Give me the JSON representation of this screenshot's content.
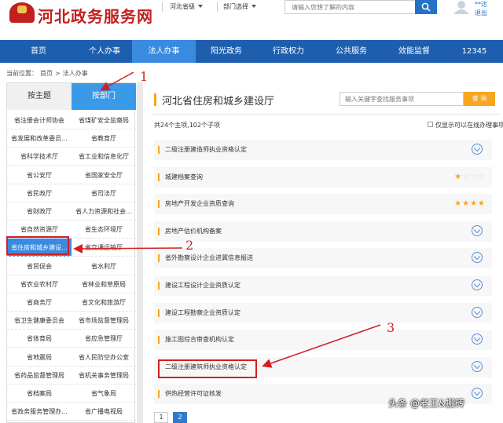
{
  "header": {
    "logo_text": "河北政务服务网",
    "province_select": "河北省级",
    "dept_select": "部门选择",
    "search_placeholder": "请输入您想了解的内容",
    "user_name": "**达",
    "logout": "退出"
  },
  "nav": {
    "items": [
      "首页",
      "个人办事",
      "法人办事",
      "阳光政务",
      "行政权力",
      "公共服务",
      "效能监督",
      "12345"
    ],
    "active_index": 2
  },
  "breadcrumb": {
    "prefix": "当前位置：",
    "home": "首页",
    "sep": ">",
    "current": "法人办事"
  },
  "left_tabs": {
    "by_subject": "按主题",
    "by_dept": "按部门"
  },
  "departments": [
    "省注册会计师协会",
    "省煤矿安全监察局",
    "省发展和改革委员...",
    "省教育厅",
    "省科学技术厅",
    "省工业和信息化厅",
    "省公安厅",
    "省国家安全厅",
    "省民政厅",
    "省司法厅",
    "省财政厅",
    "省人力资源和社会...",
    "省自然资源厅",
    "省生态环境厅",
    "省住房和城乡建设...",
    "省交通运输厅",
    "省贸促会",
    "省水利厅",
    "省农业农村厅",
    "省林业和草原局",
    "省商务厅",
    "省文化和旅游厅",
    "省卫生健康委员会",
    "省市场监督管理局",
    "省体育局",
    "省应急管理厅",
    "省地震局",
    "省人民防空办公室",
    "省药品监督管理局",
    "省机关事务管理局",
    "省档案局",
    "省气象局",
    "省政务服务管理办...",
    "省广播电视局"
  ],
  "active_department": "省住房和城乡建设...",
  "main": {
    "title": "河北省住房和城乡建设厅",
    "search_placeholder": "输入关键字查找服务事项",
    "search_button": "查 询",
    "count_text": "共24个主项,102个子项",
    "online_only_label": "仅显示可以在线办理事项",
    "items": [
      {
        "label": "二级注册建造师执业资格认定",
        "kind": "expand"
      },
      {
        "label": "城建档案查询",
        "kind": "stars",
        "rating": 1
      },
      {
        "label": "房地产开发企业资质查询",
        "kind": "stars",
        "rating": 4
      },
      {
        "label": "房地产估价机构备案",
        "kind": "expand"
      },
      {
        "label": "省外勘察设计企业进冀信息报送",
        "kind": "expand"
      },
      {
        "label": "建设工程设计企业资质认定",
        "kind": "expand"
      },
      {
        "label": "建设工程勘察企业资质认定",
        "kind": "expand"
      },
      {
        "label": "施工图综合审查机构认定",
        "kind": "expand"
      },
      {
        "label": "二级注册建筑师执业资格认定",
        "kind": "expand"
      },
      {
        "label": "供热经营许可证核发",
        "kind": "expand"
      }
    ],
    "pages": [
      "1",
      "2"
    ],
    "active_page": "2"
  },
  "annotations": {
    "step1": "1",
    "step2": "2",
    "step3": "3",
    "color": "#d21f1f"
  },
  "watermark": "头条 @老王&搬砖",
  "colors": {
    "nav_bg": "#1d5fae",
    "nav_active": "#3a8ae0",
    "accent_orange": "#f5a623",
    "logo_red": "#c21f1f"
  }
}
